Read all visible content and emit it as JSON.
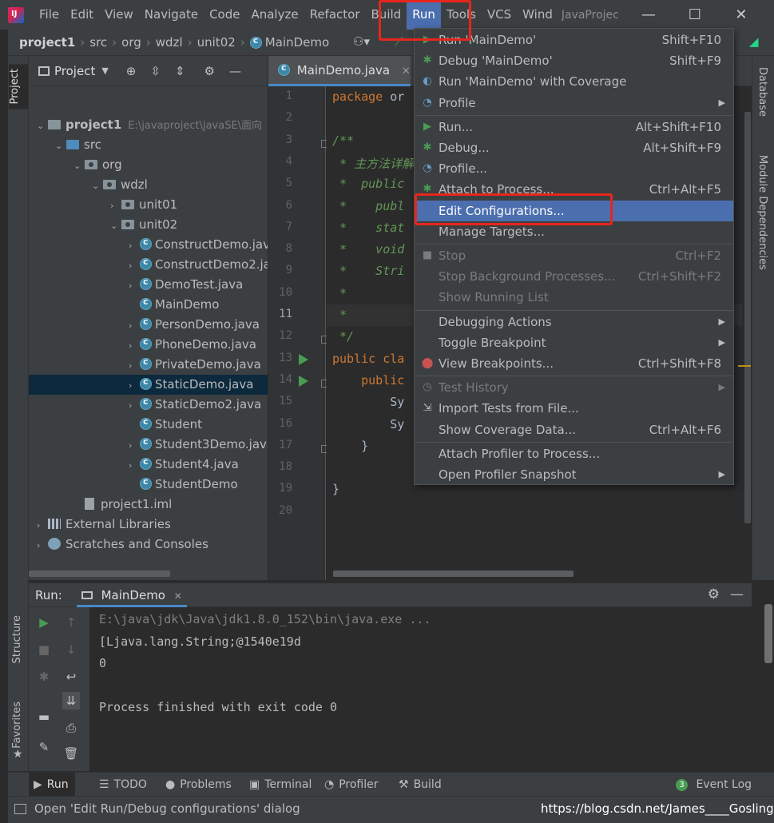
{
  "titlebar": {
    "menu": [
      "File",
      "Edit",
      "View",
      "Navigate",
      "Code",
      "Analyze",
      "Refactor",
      "Build",
      "Run",
      "Tools",
      "VCS",
      "Wind"
    ],
    "active_menu": "Run",
    "window_title": "JavaProjec",
    "minimize": "—",
    "maximize": "☐",
    "close": "✕"
  },
  "navbar": {
    "crumbs": [
      "project1",
      "src",
      "org",
      "wdzl",
      "unit02"
    ],
    "current_class": "MainDemo"
  },
  "left_strip": {
    "project_tab": "Project",
    "structure_tab": "Structure",
    "favorites_tab": "Favorites"
  },
  "project_panel": {
    "title": "Project",
    "tree": [
      {
        "label": "project1",
        "hint": "E:\\javaproject\\javaSE\\面向",
        "depth": 0,
        "arrow": "⌄",
        "icon": "folder"
      },
      {
        "label": "src",
        "depth": 1,
        "arrow": "⌄",
        "icon": "folder-blue"
      },
      {
        "label": "org",
        "depth": 2,
        "arrow": "⌄",
        "icon": "package"
      },
      {
        "label": "wdzl",
        "depth": 3,
        "arrow": "⌄",
        "icon": "package"
      },
      {
        "label": "unit01",
        "depth": 4,
        "arrow": "›",
        "icon": "package"
      },
      {
        "label": "unit02",
        "depth": 4,
        "arrow": "⌄",
        "icon": "package"
      },
      {
        "label": "ConstructDemo.java",
        "depth": 5,
        "arrow": "›",
        "icon": "class"
      },
      {
        "label": "ConstructDemo2.java",
        "depth": 5,
        "arrow": "›",
        "icon": "class"
      },
      {
        "label": "DemoTest.java",
        "depth": 5,
        "arrow": "›",
        "icon": "class"
      },
      {
        "label": "MainDemo",
        "depth": 5,
        "arrow": "",
        "icon": "class"
      },
      {
        "label": "PersonDemo.java",
        "depth": 5,
        "arrow": "›",
        "icon": "class"
      },
      {
        "label": "PhoneDemo.java",
        "depth": 5,
        "arrow": "›",
        "icon": "class"
      },
      {
        "label": "PrivateDemo.java",
        "depth": 5,
        "arrow": "›",
        "icon": "class"
      },
      {
        "label": "StaticDemo.java",
        "depth": 5,
        "arrow": "›",
        "icon": "class",
        "selected": true
      },
      {
        "label": "StaticDemo2.java",
        "depth": 5,
        "arrow": "›",
        "icon": "class"
      },
      {
        "label": "Student",
        "depth": 5,
        "arrow": "",
        "icon": "class"
      },
      {
        "label": "Student3Demo.java",
        "depth": 5,
        "arrow": "›",
        "icon": "class"
      },
      {
        "label": "Student4.java",
        "depth": 5,
        "arrow": "›",
        "icon": "class"
      },
      {
        "label": "StudentDemo",
        "depth": 5,
        "arrow": "",
        "icon": "class"
      },
      {
        "label": "project1.iml",
        "depth": 2,
        "arrow": "",
        "icon": "file"
      },
      {
        "label": "External Libraries",
        "depth": 0,
        "arrow": "›",
        "icon": "library"
      },
      {
        "label": "Scratches and Consoles",
        "depth": 0,
        "arrow": "›",
        "icon": "scratch"
      }
    ]
  },
  "editor": {
    "tab_label": "MainDemo.java",
    "current_line": 11,
    "lines": [
      {
        "n": 1,
        "segs": [
          {
            "t": "package ",
            "c": "kw"
          },
          {
            "t": "or",
            "c": "pl"
          }
        ]
      },
      {
        "n": 2,
        "segs": []
      },
      {
        "n": 3,
        "segs": [
          {
            "t": "/**",
            "c": "cm"
          }
        ]
      },
      {
        "n": 4,
        "segs": [
          {
            "t": " * 主方法详解",
            "c": "cm"
          }
        ]
      },
      {
        "n": 5,
        "segs": [
          {
            "t": " *  public",
            "c": "cm"
          }
        ]
      },
      {
        "n": 6,
        "segs": [
          {
            "t": " *    publ",
            "c": "cm"
          }
        ]
      },
      {
        "n": 7,
        "segs": [
          {
            "t": " *    stat",
            "c": "cm"
          }
        ]
      },
      {
        "n": 8,
        "segs": [
          {
            "t": " *    void",
            "c": "cm"
          }
        ]
      },
      {
        "n": 9,
        "segs": [
          {
            "t": " *    Stri",
            "c": "cm"
          }
        ]
      },
      {
        "n": 10,
        "segs": [
          {
            "t": " *",
            "c": "cm"
          }
        ]
      },
      {
        "n": 11,
        "segs": [
          {
            "t": " *",
            "c": "cm"
          }
        ]
      },
      {
        "n": 12,
        "segs": [
          {
            "t": " */",
            "c": "cm"
          }
        ]
      },
      {
        "n": 13,
        "segs": [
          {
            "t": "public ",
            "c": "kw"
          },
          {
            "t": "cla",
            "c": "kw"
          }
        ]
      },
      {
        "n": 14,
        "segs": [
          {
            "t": "    public",
            "c": "kw"
          }
        ]
      },
      {
        "n": 15,
        "segs": [
          {
            "t": "        Sy",
            "c": "pl"
          }
        ]
      },
      {
        "n": 16,
        "segs": [
          {
            "t": "        Sy",
            "c": "pl"
          }
        ]
      },
      {
        "n": 17,
        "segs": [
          {
            "t": "    }",
            "c": "pl"
          }
        ]
      },
      {
        "n": 18,
        "segs": []
      },
      {
        "n": 19,
        "segs": [
          {
            "t": "}",
            "c": "pl"
          }
        ]
      },
      {
        "n": 20,
        "segs": []
      }
    ],
    "run_lines": [
      13,
      14
    ]
  },
  "right_strip": {
    "database_tab": "Database",
    "module_tab": "Module Dependencies"
  },
  "run_panel": {
    "label": "Run:",
    "tab": "MainDemo",
    "console": [
      {
        "text": "E:\\java\\jdk\\Java\\jdk1.8.0_152\\bin\\java.exe ...",
        "kind": "cmd"
      },
      {
        "text": "[Ljava.lang.String;@1540e19d",
        "kind": "out"
      },
      {
        "text": "0",
        "kind": "out"
      },
      {
        "text": "",
        "kind": "out"
      },
      {
        "text": "Process finished with exit code 0",
        "kind": "out"
      }
    ]
  },
  "bottom_tabs": [
    {
      "label": "Run",
      "icon": "run-icon",
      "glyph": "▶",
      "active": true
    },
    {
      "label": "TODO",
      "icon": "todo-icon",
      "glyph": "☰"
    },
    {
      "label": "Problems",
      "icon": "problems-icon",
      "glyph": "●"
    },
    {
      "label": "Terminal",
      "icon": "terminal-icon",
      "glyph": "▣"
    },
    {
      "label": "Profiler",
      "icon": "profiler-icon",
      "glyph": "◔"
    },
    {
      "label": "Build",
      "icon": "build-icon",
      "glyph": "⚒"
    }
  ],
  "event_log": {
    "label": "Event Log",
    "count": "3"
  },
  "statusbar": {
    "text": "Open 'Edit Run/Debug configurations' dialog",
    "watermark": "https://blog.csdn.net/James____Gosling"
  },
  "run_menu": {
    "items": [
      {
        "label": "Run 'MainDemo'",
        "shortcut": "Shift+F10",
        "icon": "run-icon",
        "glyph": "▶",
        "ic": "play"
      },
      {
        "label": "Debug 'MainDemo'",
        "shortcut": "Shift+F9",
        "icon": "debug-icon",
        "glyph": "✱",
        "ic": "bug"
      },
      {
        "label": "Run 'MainDemo' with Coverage",
        "shortcut": "",
        "icon": "coverage-icon",
        "glyph": "◐",
        "ic": "blue"
      },
      {
        "label": "Profile",
        "shortcut": "",
        "icon": "profile-icon",
        "glyph": "◔",
        "ic": "blue",
        "submenu": true
      },
      {
        "sep": true
      },
      {
        "label": "Run...",
        "shortcut": "Alt+Shift+F10",
        "icon": "run-icon",
        "glyph": "▶",
        "ic": "play"
      },
      {
        "label": "Debug...",
        "shortcut": "Alt+Shift+F9",
        "icon": "debug-icon",
        "glyph": "✱",
        "ic": "bug"
      },
      {
        "label": "Profile...",
        "shortcut": "",
        "icon": "profile-icon",
        "glyph": "◔",
        "ic": "blue"
      },
      {
        "label": "Attach to Process...",
        "shortcut": "Ctrl+Alt+F5",
        "icon": "attach-icon",
        "glyph": "✱",
        "ic": "bug"
      },
      {
        "label": "Edit Configurations...",
        "shortcut": "",
        "icon": "",
        "glyph": "",
        "ic": "",
        "highlighted": true
      },
      {
        "label": "Manage Targets...",
        "shortcut": "",
        "icon": "",
        "glyph": "",
        "ic": ""
      },
      {
        "sep": true
      },
      {
        "label": "Stop",
        "shortcut": "Ctrl+F2",
        "icon": "stop-icon",
        "glyph": "■",
        "ic": "grey",
        "disabled": true
      },
      {
        "label": "Stop Background Processes...",
        "shortcut": "Ctrl+Shift+F2",
        "icon": "",
        "glyph": "",
        "ic": "",
        "disabled": true
      },
      {
        "label": "Show Running List",
        "shortcut": "",
        "icon": "",
        "glyph": "",
        "ic": "",
        "disabled": true
      },
      {
        "sep": true
      },
      {
        "label": "Debugging Actions",
        "shortcut": "",
        "icon": "",
        "glyph": "",
        "ic": "",
        "submenu": true
      },
      {
        "label": "Toggle Breakpoint",
        "shortcut": "",
        "icon": "",
        "glyph": "",
        "ic": "",
        "submenu": true
      },
      {
        "label": "View Breakpoints...",
        "shortcut": "Ctrl+Shift+F8",
        "icon": "breakpoint-icon",
        "glyph": "⬤",
        "ic": "red"
      },
      {
        "sep": true
      },
      {
        "label": "Test History",
        "shortcut": "",
        "icon": "history-icon",
        "glyph": "◷",
        "ic": "grey",
        "disabled": true,
        "submenu": true
      },
      {
        "label": "Import Tests from File...",
        "shortcut": "",
        "icon": "import-icon",
        "glyph": "⇲",
        "ic": "",
        "submenu": false
      },
      {
        "label": "Show Coverage Data...",
        "shortcut": "Ctrl+Alt+F6",
        "icon": "",
        "glyph": "",
        "ic": ""
      },
      {
        "sep": true
      },
      {
        "label": "Attach Profiler to Process...",
        "shortcut": "",
        "icon": "",
        "glyph": "",
        "ic": ""
      },
      {
        "label": "Open Profiler Snapshot",
        "shortcut": "",
        "icon": "",
        "glyph": "",
        "ic": "",
        "submenu": true
      }
    ]
  }
}
